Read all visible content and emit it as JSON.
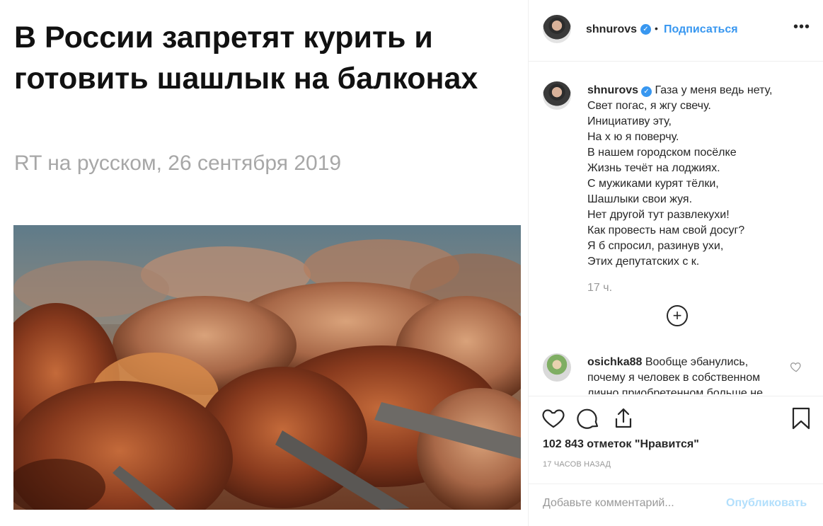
{
  "article": {
    "headline": "В России запретят курить и готовить шашлык на балконах",
    "source": "RT на русском, 26 сентября 2019"
  },
  "post": {
    "username": "shnurovs",
    "separator": "•",
    "follow_label": "Подписаться",
    "more_label": "•••",
    "caption_lines": [
      "Газа у меня ведь нету,",
      "Свет погас, я жгу свечу.",
      "Инициативу эту,",
      "На х  ю я поверчу.",
      "В нашем городском посёлке",
      "Жизнь течёт на лоджиях.",
      "С мужиками курят тёлки,",
      "Шашлыки свои жуя.",
      "Нет другой тут развлекухи!",
      "Как провесть нам свой досуг?",
      "Я б спросил, разинув ухи,",
      "Этих депутатских с  к."
    ],
    "caption_time": "17 ч.",
    "load_more_icon": "plus-circle-icon",
    "comment": {
      "username": "osichka88",
      "text": "Вообще эбанулись, почему я человек в собственном лично приобретенном больше не"
    },
    "likes": "102 843 отметок \"Нравится\"",
    "posted_ago": "17 часов назад",
    "comment_placeholder": "Добавьте комментарий...",
    "publish_label": "Опубликовать"
  },
  "colors": {
    "accent": "#3897f0",
    "publish_disabled": "#b2dffc",
    "muted": "#999999",
    "source_gray": "#a7a7a7"
  }
}
